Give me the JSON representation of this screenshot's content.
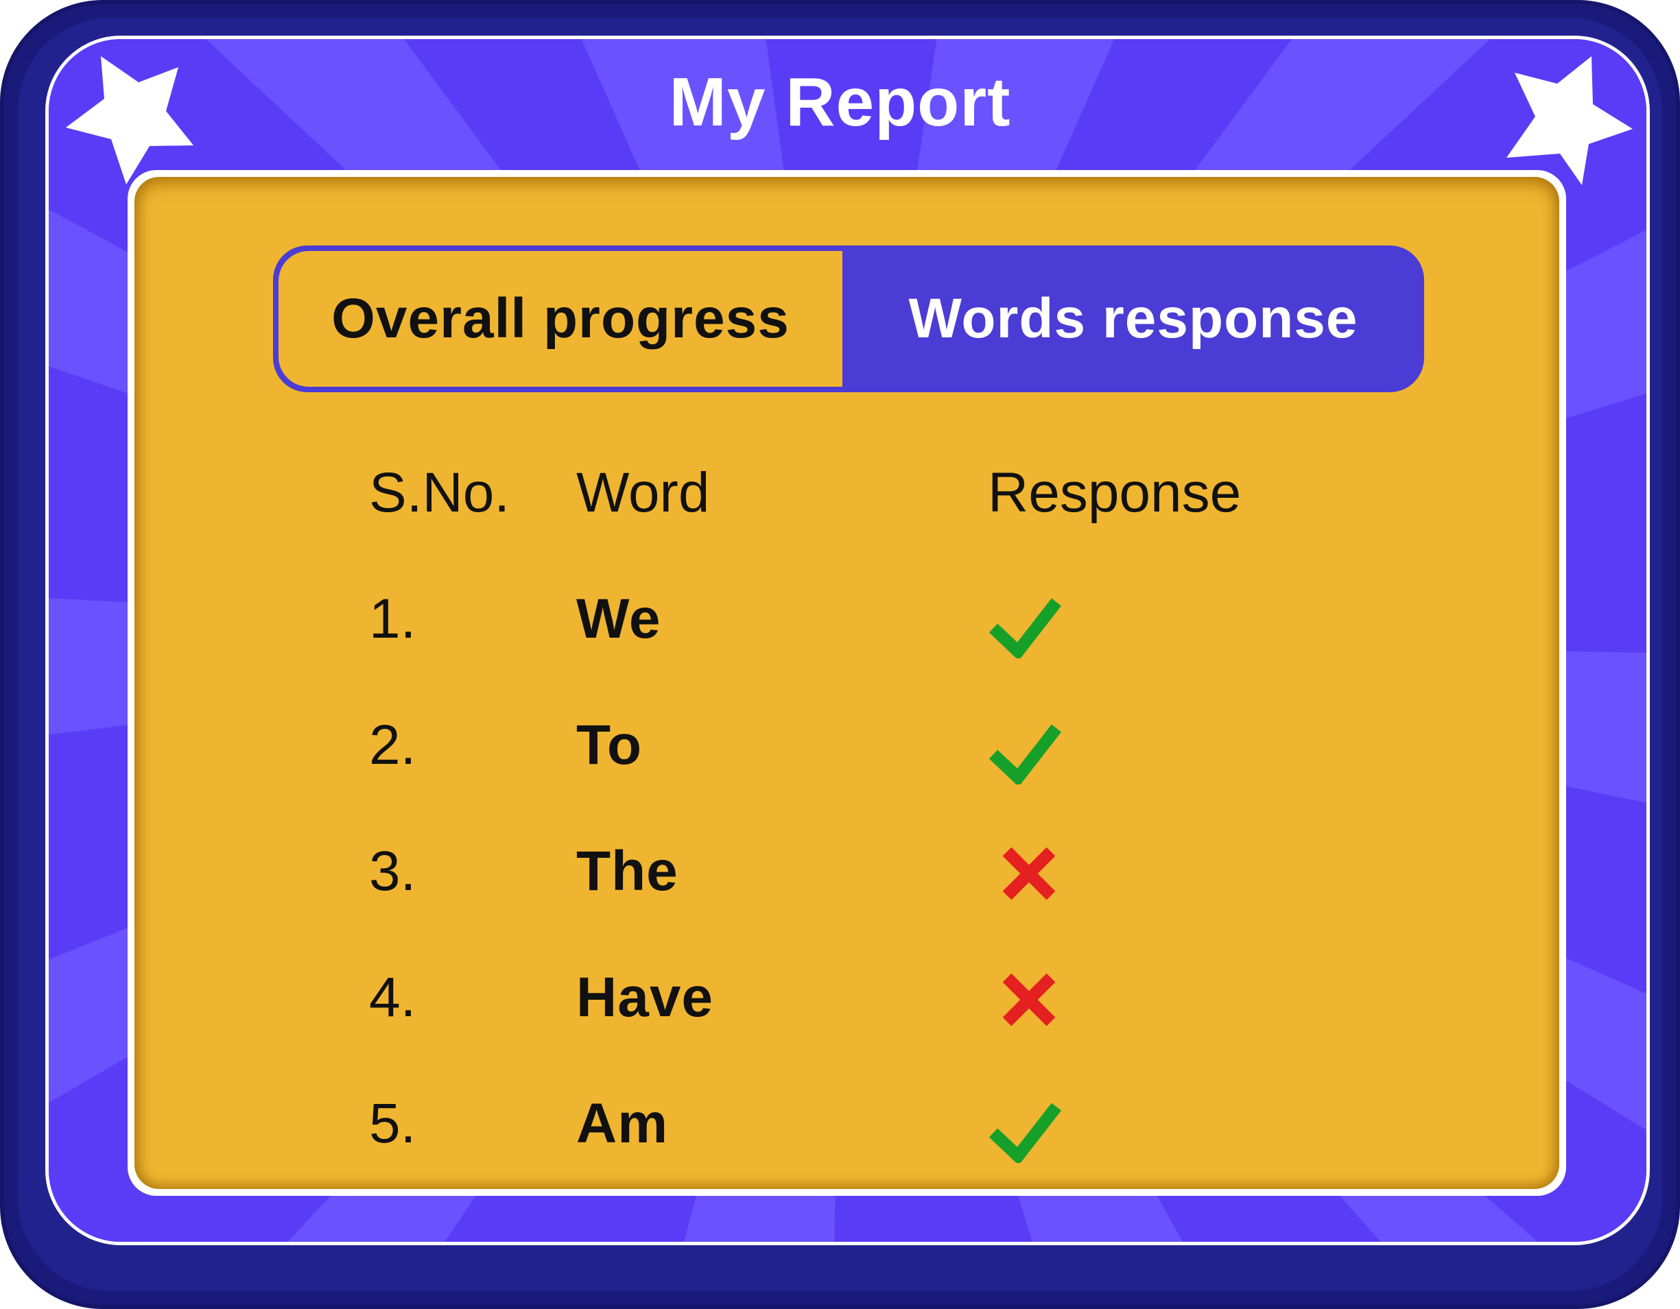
{
  "app": {
    "title": "My Report"
  },
  "tabs": [
    {
      "label": "Overall progress",
      "active": false
    },
    {
      "label": "Words response",
      "active": true
    }
  ],
  "table": {
    "columns": [
      "S.No.",
      "Word",
      "Response"
    ],
    "rows": [
      {
        "num": "1.",
        "word": "We",
        "response": "check-icon"
      },
      {
        "num": "2.",
        "word": "To",
        "response": "check-icon"
      },
      {
        "num": "3.",
        "word": "The",
        "response": "cross-icon"
      },
      {
        "num": "4.",
        "word": "Have",
        "response": "cross-icon"
      },
      {
        "num": "5.",
        "word": "Am",
        "response": "check-icon"
      }
    ]
  },
  "colors": {
    "frame": "#1a1a7a",
    "panel": "#5a3cf6",
    "card": "#f0b530",
    "tab_active": "#4a3cd4",
    "correct": "#16a02a",
    "incorrect": "#e42020"
  }
}
